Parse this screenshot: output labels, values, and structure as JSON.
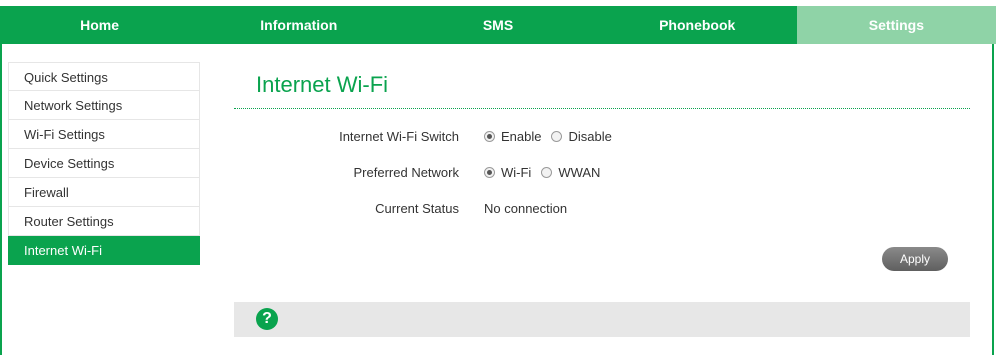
{
  "nav": {
    "tabs": [
      {
        "label": "Home"
      },
      {
        "label": "Information"
      },
      {
        "label": "SMS"
      },
      {
        "label": "Phonebook"
      },
      {
        "label": "Settings"
      }
    ],
    "active": "Settings"
  },
  "sidebar": {
    "items": [
      {
        "label": "Quick Settings"
      },
      {
        "label": "Network Settings"
      },
      {
        "label": "Wi-Fi Settings"
      },
      {
        "label": "Device Settings"
      },
      {
        "label": "Firewall"
      },
      {
        "label": "Router Settings"
      },
      {
        "label": "Internet Wi-Fi"
      }
    ],
    "active": "Internet Wi-Fi"
  },
  "main": {
    "title": "Internet Wi-Fi",
    "switch": {
      "label": "Internet Wi-Fi Switch",
      "options": [
        "Enable",
        "Disable"
      ],
      "selected": "Enable"
    },
    "preferred": {
      "label": "Preferred Network",
      "options": [
        "Wi-Fi",
        "WWAN"
      ],
      "selected": "Wi-Fi"
    },
    "status": {
      "label": "Current Status",
      "value": "No connection"
    },
    "apply_label": "Apply",
    "help_icon": "question-mark-icon"
  },
  "colors": {
    "accent": "#0aa34e",
    "active_tab": "#8fd3a7",
    "help_bar": "#e7e7e7"
  }
}
